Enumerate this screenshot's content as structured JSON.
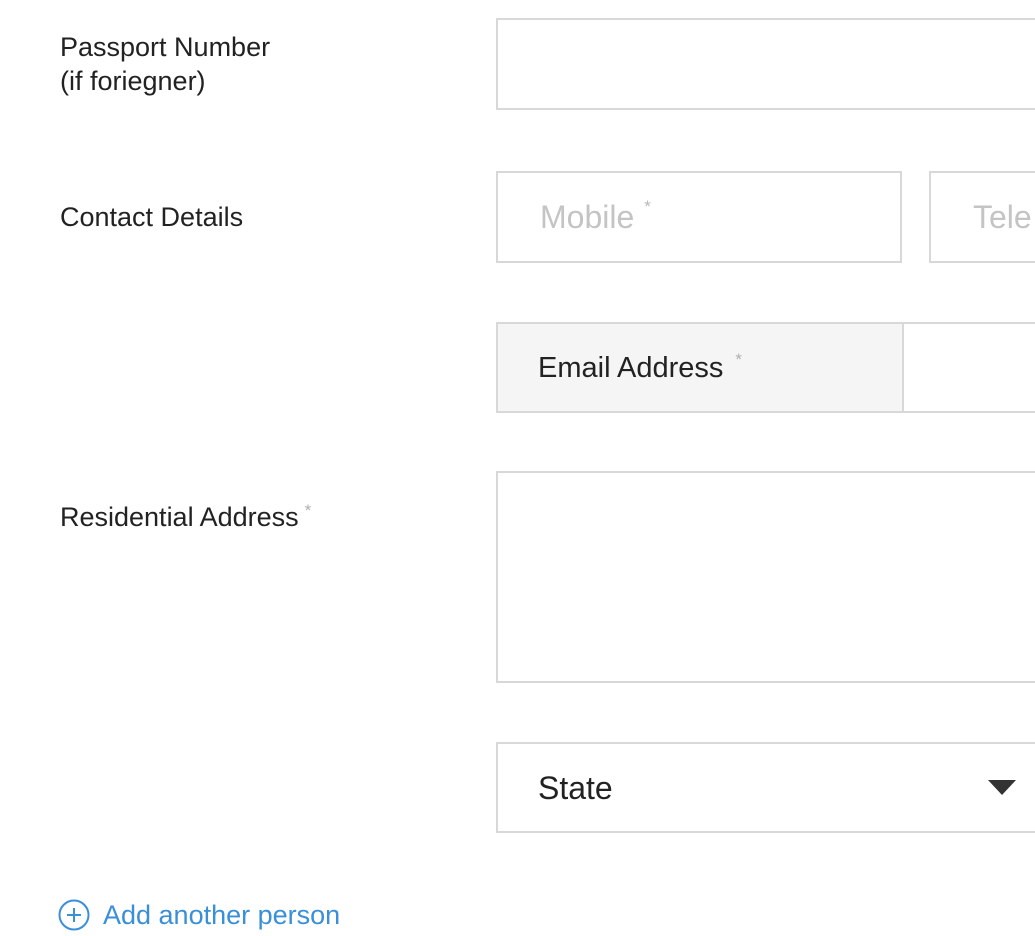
{
  "form": {
    "passport": {
      "label_line1": "Passport Number",
      "label_line2": "(if foriegner)",
      "value": ""
    },
    "contact": {
      "label": "Contact Details",
      "mobile_placeholder": "Mobile",
      "mobile_required": "*",
      "telephone_placeholder": "Tele",
      "email_addon": "Email Address",
      "email_required": "*",
      "email_value": ""
    },
    "residential": {
      "label": "Residential Address",
      "required": "*",
      "value": ""
    },
    "state": {
      "selected": "State",
      "icon": "caret-down-icon"
    },
    "add_person": {
      "label": "Add another person",
      "icon": "plus-circle-icon"
    }
  },
  "colors": {
    "link": "#3a8fd9",
    "border": "#d8d8d8",
    "addon_bg": "#f5f5f5",
    "placeholder": "#c4c4c4",
    "required": "#b0b0b0"
  }
}
